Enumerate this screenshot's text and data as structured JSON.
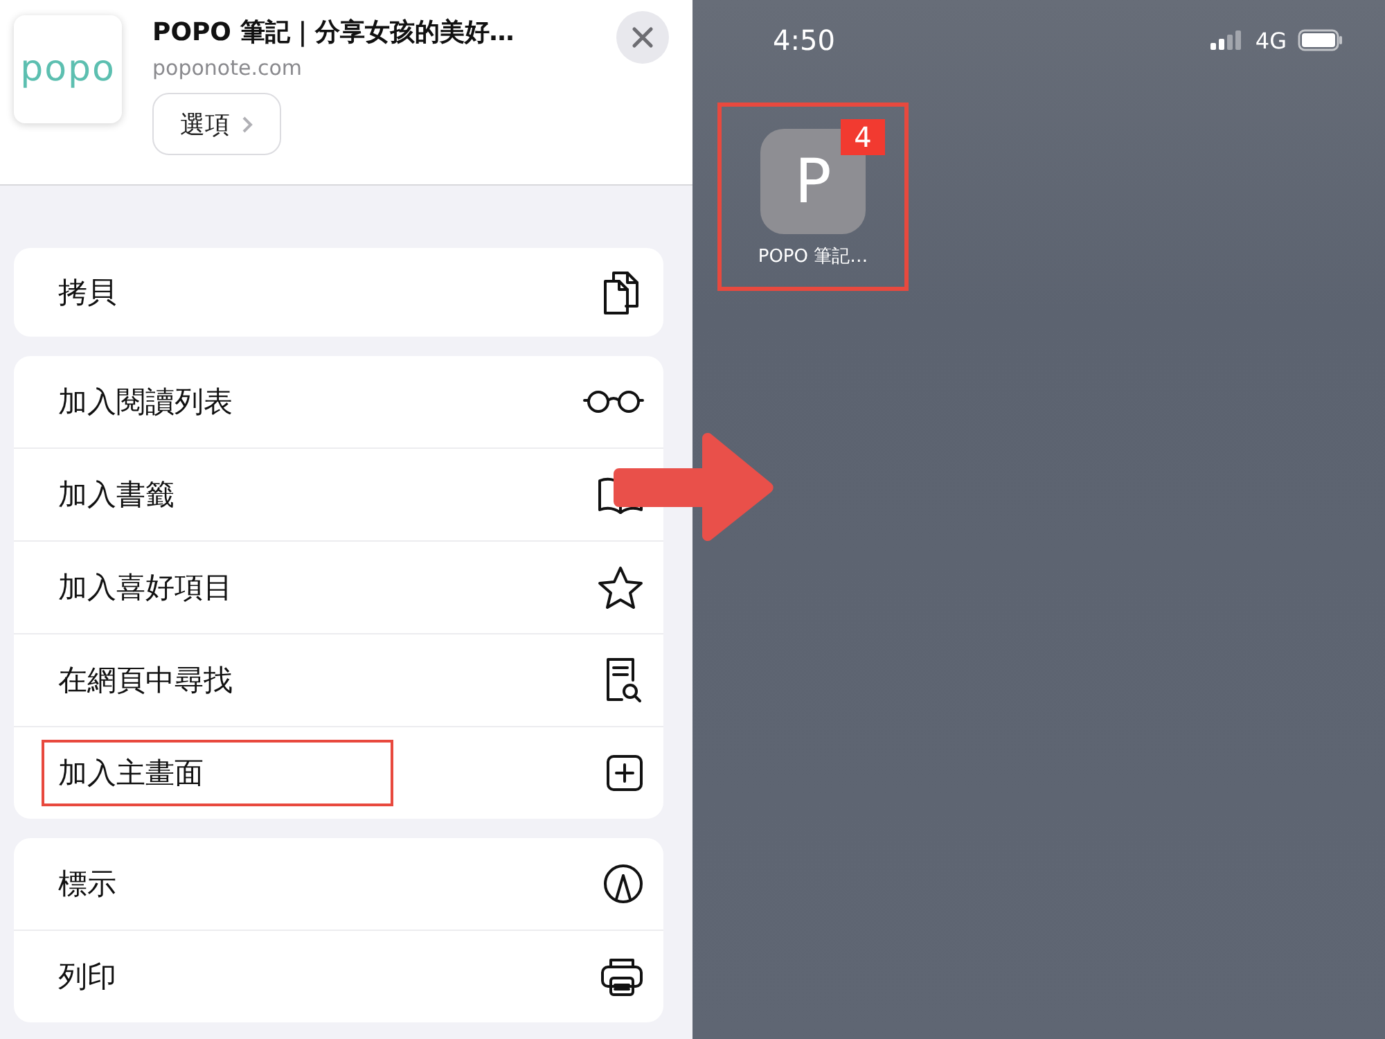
{
  "share_sheet": {
    "logo_text": "popo",
    "title": "POPO 筆記｜分享女孩的美好…",
    "url": "poponote.com",
    "options_button": "選項",
    "sections": [
      {
        "items": [
          {
            "label": "拷貝",
            "highlighted": false
          }
        ]
      },
      {
        "items": [
          {
            "label": "加入閱讀列表",
            "highlighted": false
          },
          {
            "label": "加入書籤",
            "highlighted": false
          },
          {
            "label": "加入喜好項目",
            "highlighted": false
          },
          {
            "label": "在網頁中尋找",
            "highlighted": false
          },
          {
            "label": "加入主畫面",
            "highlighted": true
          }
        ]
      },
      {
        "items": [
          {
            "label": "標示",
            "highlighted": false
          },
          {
            "label": "列印",
            "highlighted": false
          }
        ]
      }
    ]
  },
  "home_screen": {
    "status_bar": {
      "time": "4:50",
      "network": "4G"
    },
    "app": {
      "letter": "P",
      "badge": "4",
      "name": "POPO 筆記…",
      "highlighted": true
    }
  }
}
